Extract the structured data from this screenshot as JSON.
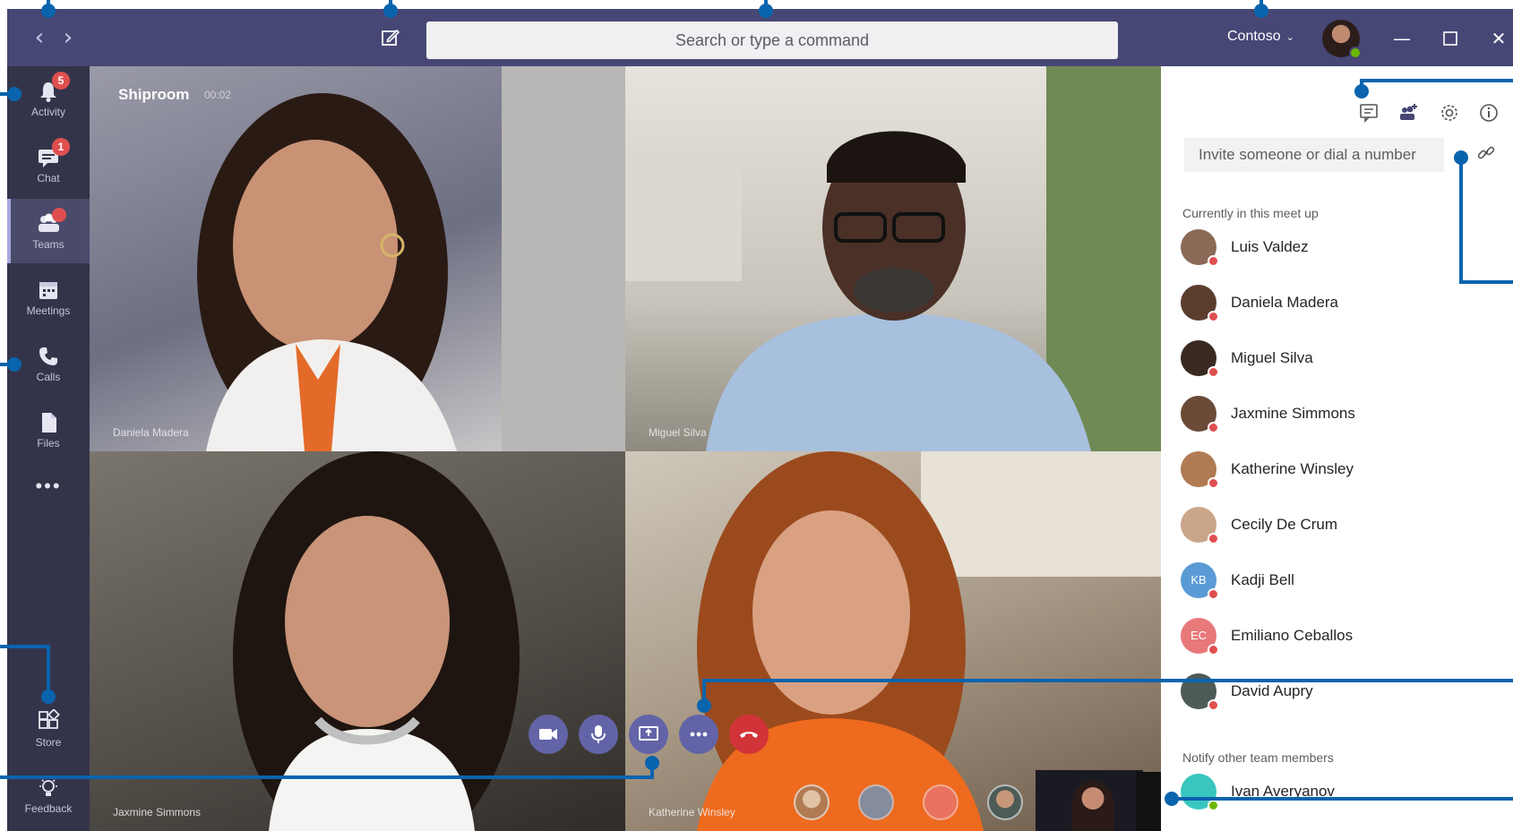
{
  "topbar": {
    "back_icon": "chevron-left-icon",
    "forward_icon": "chevron-right-icon",
    "compose_icon": "compose-icon",
    "search_placeholder": "Search or type a command",
    "tenant_label": "Contoso",
    "window_controls": [
      "minimize-icon",
      "maximize-icon",
      "close-icon"
    ],
    "bar_color": "#464775"
  },
  "rail": {
    "items": [
      {
        "label": "Activity",
        "icon": "bell-icon",
        "badge": "5"
      },
      {
        "label": "Chat",
        "icon": "chat-icon",
        "badge": "1"
      },
      {
        "label": "Teams",
        "icon": "teams-icon",
        "badge": "",
        "active": true
      },
      {
        "label": "Meetings",
        "icon": "calendar-icon",
        "badge": ""
      },
      {
        "label": "Calls",
        "icon": "phone-icon",
        "badge": ""
      },
      {
        "label": "Files",
        "icon": "file-icon",
        "badge": ""
      },
      {
        "label": "",
        "icon": "more-icon",
        "badge": ""
      }
    ],
    "bottom_items": [
      {
        "label": "Store",
        "icon": "store-icon"
      },
      {
        "label": "Feedback",
        "icon": "lightbulb-icon"
      }
    ]
  },
  "meeting": {
    "title": "Shiproom",
    "timer": "00:02",
    "participants_tiles": [
      {
        "name": "Daniela Madera"
      },
      {
        "name": "Miguel Silva"
      },
      {
        "name": "Jaxmine Simmons"
      },
      {
        "name": "Katherine Winsley"
      }
    ],
    "controls": [
      "camera-icon",
      "microphone-icon",
      "share-screen-icon",
      "more-options-icon",
      "hang-up-icon"
    ],
    "accent": "#6264a7",
    "hangup_color": "#d13438"
  },
  "panel": {
    "tools": [
      "chat-bubble-icon",
      "add-people-icon",
      "settings-icon",
      "info-icon"
    ],
    "invite_placeholder": "Invite someone or dial a number",
    "link_icon": "link-icon",
    "current_label": "Currently in this meet up",
    "people": [
      {
        "name": "Luis Valdez",
        "initials": "",
        "color": "#8a6a56"
      },
      {
        "name": "Daniela Madera",
        "initials": "",
        "color": "#5b3d2e"
      },
      {
        "name": "Miguel Silva",
        "initials": "",
        "color": "#3a2a22"
      },
      {
        "name": "Jaxmine Simmons",
        "initials": "",
        "color": "#6b4a38"
      },
      {
        "name": "Katherine Winsley",
        "initials": "",
        "color": "#b07a52"
      },
      {
        "name": "Cecily De Crum",
        "initials": "",
        "color": "#c9a58a"
      },
      {
        "name": "Kadji Bell",
        "initials": "KB",
        "color": "#5a9bd5"
      },
      {
        "name": "Emiliano Ceballos",
        "initials": "EC",
        "color": "#e8787a"
      },
      {
        "name": "David Aupry",
        "initials": "",
        "color": "#4d5b57"
      }
    ],
    "notify_label": "Notify other team members",
    "notify_people": [
      {
        "name": "Ivan Averyanov",
        "initials": "",
        "color": "#39c6c0"
      }
    ]
  }
}
